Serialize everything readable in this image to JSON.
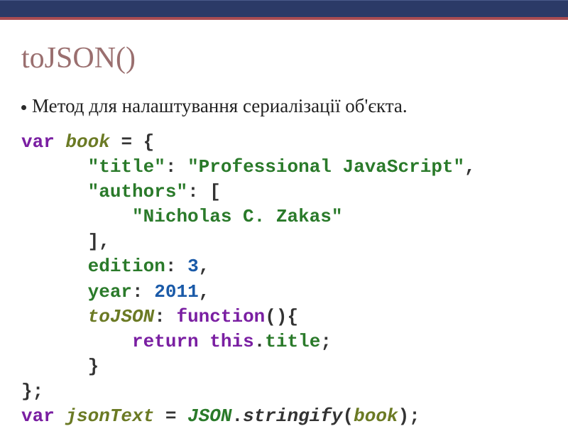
{
  "slide": {
    "heading": "toJSON()",
    "bullet": "Метод для налаштування сериалізації об'єкта.",
    "code": {
      "kw_var1": "var",
      "book": "book",
      "eq": " = {",
      "title_key": "\"title\"",
      "title_val": "\"Professional JavaScript\"",
      "authors_key": "\"authors\"",
      "authors_open": "[",
      "author1": "\"Nicholas C. Zakas\"",
      "authors_close": "]",
      "edition_key": "edition",
      "edition_val": "3",
      "year_key": "year",
      "year_val": "2011",
      "tojson_key": "toJSON",
      "fn_kw": "function",
      "fn_paren": "(){",
      "return_kw": "return",
      "this_kw": "this",
      "title_prop": "title",
      "close_brace": "}",
      "close_obj": "};",
      "kw_var2": "var",
      "jsonText": "jsonText",
      "eq2": " = ",
      "json_type": "JSON",
      "stringify": "stringify",
      "book2": "book",
      "end": ");"
    }
  }
}
